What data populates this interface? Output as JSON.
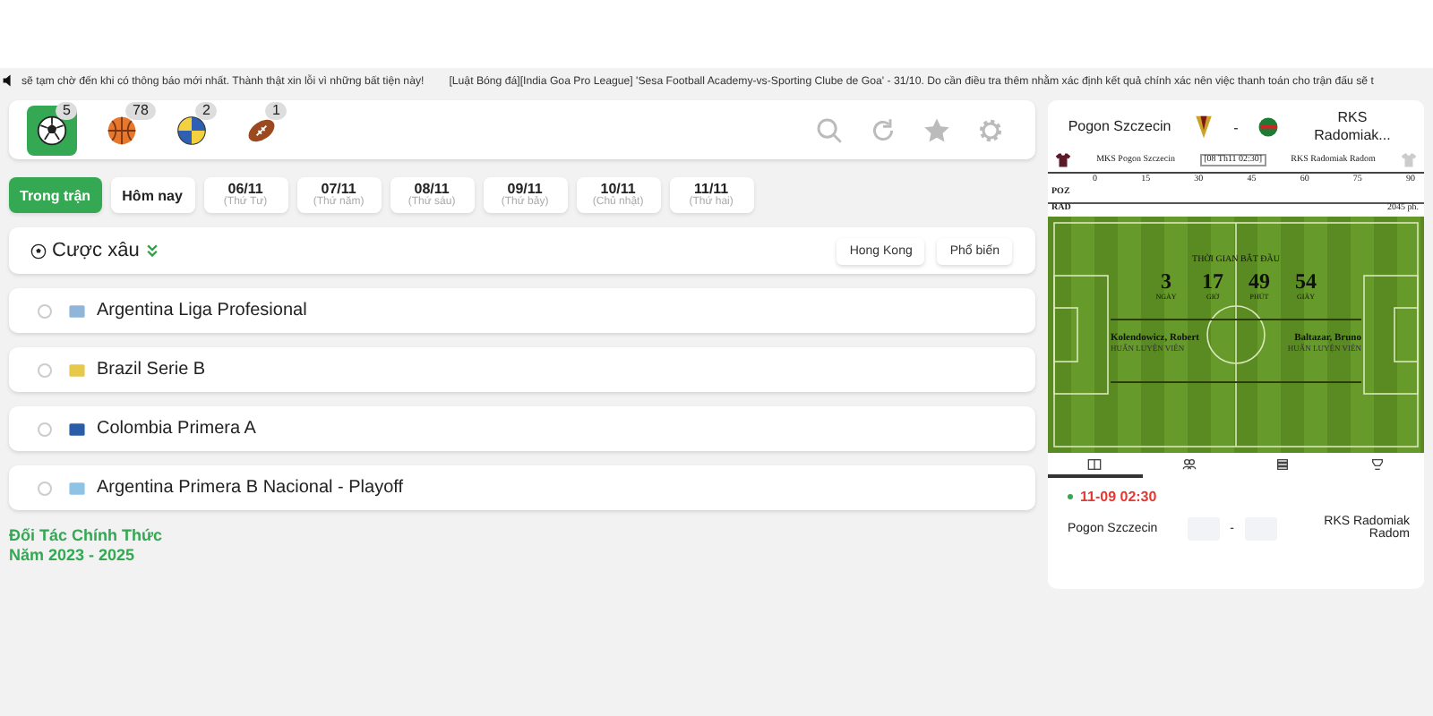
{
  "ticker": {
    "texts": [
      "sẽ tạm chờ đến khi có thông báo mới nhất. Thành thật xin lỗi vì những bất tiện này!",
      "[Luật Bóng đá][India Goa Pro League] 'Sesa Football Academy-vs-Sporting Clube de Goa' - 31/10. Do cần điều tra thêm nhằm xác định kết quả chính xác nên việc thanh toán cho trận đấu sẽ t"
    ]
  },
  "sports": [
    {
      "kind": "soccer",
      "count": "5",
      "selected": true
    },
    {
      "kind": "basketball",
      "count": "78",
      "selected": false
    },
    {
      "kind": "volleyball",
      "count": "2",
      "selected": false
    },
    {
      "kind": "football",
      "count": "1",
      "selected": false
    }
  ],
  "date_tabs": [
    {
      "label": "Trong trận",
      "selected": true
    },
    {
      "label": "Hôm nay",
      "selected": false
    },
    {
      "label": "06/11",
      "sub": "(Thứ Tư)",
      "selected": false
    },
    {
      "label": "07/11",
      "sub": "(Thứ năm)",
      "selected": false
    },
    {
      "label": "08/11",
      "sub": "(Thứ sáu)",
      "selected": false
    },
    {
      "label": "09/11",
      "sub": "(Thứ bảy)",
      "selected": false
    },
    {
      "label": "10/11",
      "sub": "(Chủ nhật)",
      "selected": false
    },
    {
      "label": "11/11",
      "sub": "(Thứ hai)",
      "selected": false
    }
  ],
  "parlay": {
    "title": "Cược xâu",
    "buttons": [
      "Hong Kong",
      "Phổ biến"
    ]
  },
  "leagues": [
    {
      "name": "Argentina Liga Profesional",
      "checked": false
    },
    {
      "name": "Brazil Serie B",
      "checked": false
    },
    {
      "name": "Colombia Primera A",
      "checked": false
    },
    {
      "name": "Argentina Primera B Nacional - Playoff",
      "checked": false
    }
  ],
  "partner": [
    "Đối Tác Chính Thức",
    "Năm 2023 - 2025"
  ],
  "match": {
    "home": "Pogon Szczecin",
    "away": "RKS Radomiak...",
    "separator": "-",
    "home_full": "MKS Pogon Szczecin",
    "kickoff": "[08 Th11 02:30]",
    "away_full": "RKS Radomiak Radom",
    "timeline_ticks": [
      "0",
      "15",
      "30",
      "45",
      "60",
      "75",
      "90"
    ],
    "home_code": "POZ",
    "away_code": "RAD",
    "timeline_note": "2045 ph.",
    "countdown_title": "THỜI GIAN BẮT ĐẦU",
    "countdown": [
      {
        "value": "3",
        "unit": "NGÀY"
      },
      {
        "value": "17",
        "unit": "GIỜ"
      },
      {
        "value": "49",
        "unit": "PHÚT"
      },
      {
        "value": "54",
        "unit": "GIÂY"
      }
    ],
    "home_coach": "Kolendowicz, Robert",
    "away_coach": "Baltazar, Bruno",
    "coach_role": [
      "HUẤN LUYỆN VIÊN",
      "HUẤN LUYỆN VIÊN"
    ],
    "tabs": [
      {
        "kind": "scoreboard",
        "selected": true
      },
      {
        "kind": "lineup",
        "selected": false
      },
      {
        "kind": "list",
        "selected": false
      },
      {
        "kind": "cup",
        "selected": false
      }
    ],
    "time": "11-09 02:30",
    "home_name": "Pogon Szczecin",
    "score_sep": "-",
    "away_name": "RKS Radomiak Radom"
  }
}
